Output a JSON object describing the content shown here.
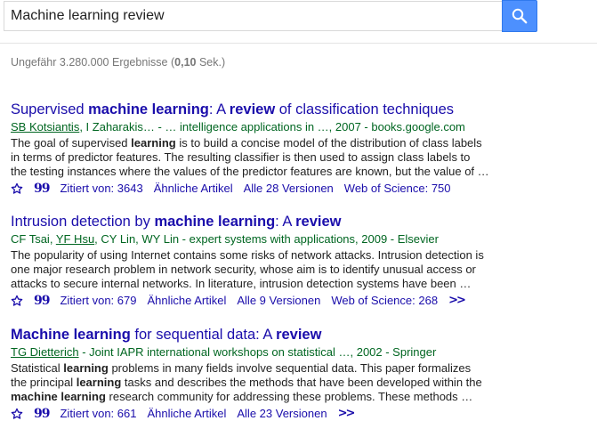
{
  "search": {
    "query": "Machine learning review",
    "button_icon": "search-icon"
  },
  "stats": {
    "prefix": "Ungefähr 3.280.000 Ergebnisse (",
    "time": "0,10",
    "suffix": " Sek.)"
  },
  "results": [
    {
      "title_parts": [
        "Supervised ",
        "machine learning",
        ": A ",
        "review",
        " of classification techniques"
      ],
      "authors_linked": [
        "SB Kotsiantis"
      ],
      "meta_rest": ", I Zaharakis… - … intelligence applications in …, 2007 - books.google.com",
      "snippet_lines": [
        [
          "The goal of supervised ",
          "learning",
          " is to build a concise model of the distribution of class labels"
        ],
        [
          "in terms of predictor features. The resulting classifier is then used to assign class labels to"
        ],
        [
          "the testing instances where the values of the predictor features are known, but the value of …"
        ]
      ],
      "cited_by": "Zitiert von: 3643",
      "related": "Ähnliche Artikel",
      "versions": "Alle 28 Versionen",
      "wos": "Web of Science: 750",
      "has_more": false
    },
    {
      "title_parts": [
        "Intrusion detection by ",
        "machine learning",
        ": A ",
        "review",
        ""
      ],
      "meta_prefix": "CF Tsai, ",
      "authors_linked": [
        "YF Hsu"
      ],
      "meta_rest": ", CY Lin, WY Lin - expert systems with applications, 2009 - Elsevier",
      "snippet_lines": [
        [
          "The popularity of using Internet contains some risks of network attacks. Intrusion detection is"
        ],
        [
          "one major research problem in network security, whose aim is to identify unusual access or"
        ],
        [
          "attacks to secure internal networks. In literature, intrusion detection systems have been …"
        ]
      ],
      "cited_by": "Zitiert von: 679",
      "related": "Ähnliche Artikel",
      "versions": "Alle 9 Versionen",
      "wos": "Web of Science: 268",
      "has_more": true
    },
    {
      "title_parts": [
        "Machine learning",
        " for sequential data: A ",
        "review",
        ""
      ],
      "authors_linked": [
        "TG Dietterich"
      ],
      "meta_rest": " - Joint IAPR international workshops on statistical …, 2002 - Springer",
      "snippet_lines": [
        [
          "Statistical ",
          "learning",
          " problems in many fields involve sequential data. This paper formalizes"
        ],
        [
          "the principal ",
          "learning",
          " tasks and describes the methods that have been developed within the"
        ],
        [
          "",
          "machine learning",
          " research community for addressing these problems. These methods …"
        ]
      ],
      "cited_by": "Zitiert von: 661",
      "related": "Ähnliche Artikel",
      "versions": "Alle 23 Versionen",
      "wos": "",
      "has_more": true
    }
  ],
  "icons": {
    "save": "star-icon",
    "cite": "quote-icon",
    "more": "double-chevron-right-icon"
  },
  "colors": {
    "link": "#1a0dab",
    "meta": "#006621",
    "snippet": "#222222",
    "stats": "#777777",
    "search_button": "#4d90fe"
  }
}
